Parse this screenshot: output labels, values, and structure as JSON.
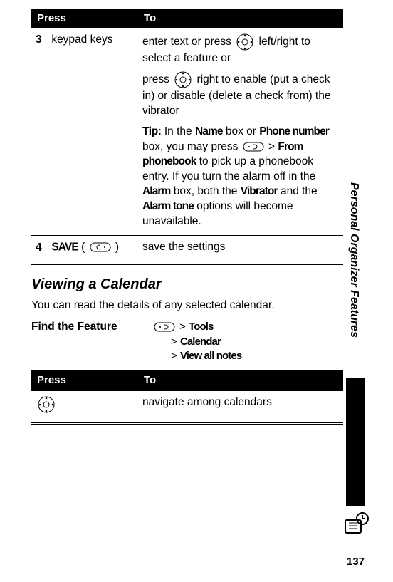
{
  "sidebar": {
    "section_label": "Personal Organizer Features",
    "page_number": "137"
  },
  "table1": {
    "head_press": "Press",
    "head_to": "To",
    "row3": {
      "num": "3",
      "press": "keypad keys",
      "to_line1a": "enter text or press ",
      "to_line1b": " left/right to select a feature or",
      "to_line2a": "press ",
      "to_line2b": " right to enable (put a check in) or disable (delete a check from) the vibrator",
      "tip_label": "Tip:",
      "tip_a": " In the ",
      "tip_name": "Name",
      "tip_b": " box or ",
      "tip_phone": "Phone number",
      "tip_c": " box, you may press ",
      "tip_from": "From phonebook",
      "tip_d": " to pick up a phonebook entry. If you turn the alarm off in the ",
      "tip_alarm": "Alarm",
      "tip_e": " box, both the ",
      "tip_vib": "Vibrator",
      "tip_f": " and the ",
      "tip_tone": "Alarm tone",
      "tip_g": " options will become unavailable.",
      "gt": " > "
    },
    "row4": {
      "num": "4",
      "save": "SAVE",
      "paren_open": " ( ",
      "paren_close": " )",
      "to": "save the settings"
    }
  },
  "section": {
    "heading": "Viewing a Calendar",
    "body": "You can read the details of any selected calendar."
  },
  "find": {
    "label": "Find the Feature",
    "p1": "Tools",
    "p2": "Calendar",
    "p3": "View all notes",
    "gt": "> "
  },
  "table2": {
    "head_press": "Press",
    "head_to": "To",
    "row": {
      "to": "navigate among calendars"
    }
  }
}
